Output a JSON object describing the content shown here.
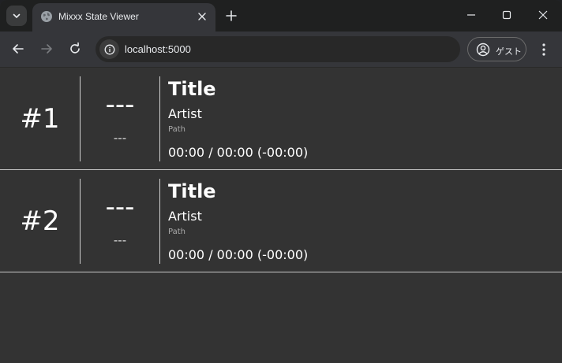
{
  "browser": {
    "tab_title": "Mixxx State Viewer",
    "url": "localhost:5000",
    "profile_label": "ゲスト"
  },
  "icons": {
    "tab_search": "chevron-down-icon",
    "favicon": "globe-icon",
    "tab_close": "close-icon",
    "new_tab": "plus-icon",
    "minimize": "minimize-icon",
    "maximize": "maximize-icon",
    "close_window": "close-icon",
    "back": "back-arrow-icon",
    "forward": "forward-arrow-icon",
    "reload": "reload-icon",
    "site_info": "info-icon",
    "profile": "person-circle-icon",
    "menu": "three-dots-vertical-icon"
  },
  "colors": {
    "page_background": "#333333",
    "text": "#ffffff",
    "path_text": "#aaaaaa",
    "divider": "#c8c8c8"
  },
  "decks": [
    {
      "number": "#1",
      "bpm": "---",
      "bpm_sub": "---",
      "title": "Title",
      "artist": "Artist",
      "path": "Path",
      "time": "00:00 / 00:00 (-00:00)"
    },
    {
      "number": "#2",
      "bpm": "---",
      "bpm_sub": "---",
      "title": "Title",
      "artist": "Artist",
      "path": "Path",
      "time": "00:00 / 00:00 (-00:00)"
    }
  ]
}
